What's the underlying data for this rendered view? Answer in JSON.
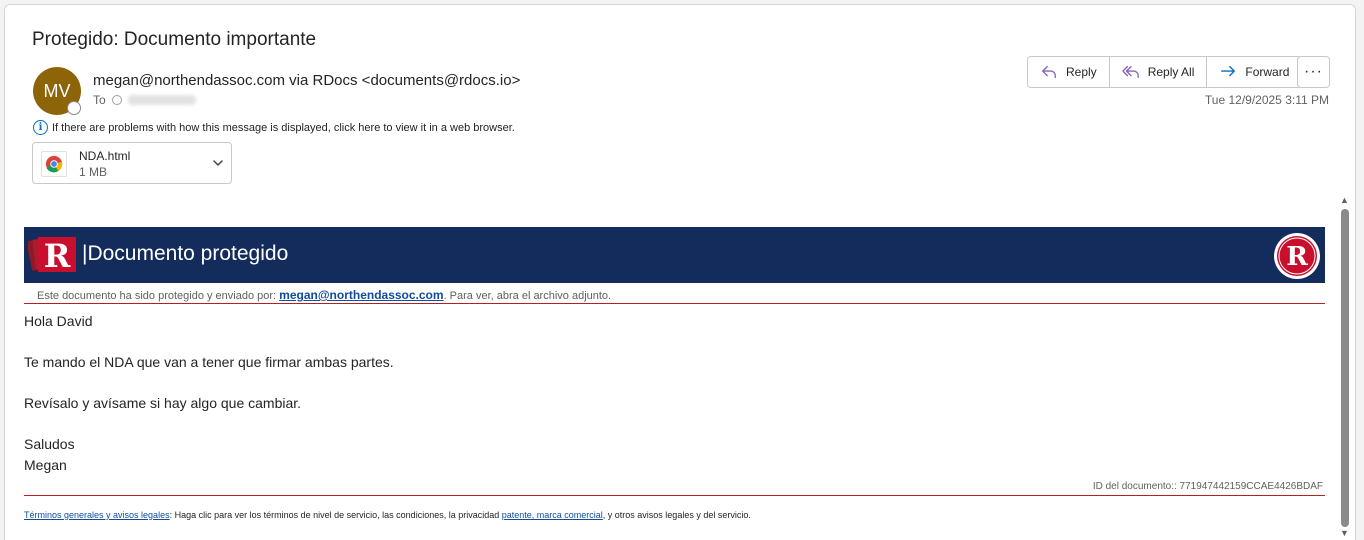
{
  "email": {
    "subject": "Protegido: Documento importante",
    "avatar_initials": "MV",
    "sender": "megan@northendassoc.com via RDocs <documents@rdocs.io>",
    "to_label": "To",
    "timestamp": "Tue 12/9/2025 3:11 PM",
    "info_message": "If there are problems with how this message is displayed, click here to view it in a web browser.",
    "actions": {
      "reply": "Reply",
      "reply_all": "Reply All",
      "forward": "Forward",
      "more": "···"
    },
    "attachment": {
      "name": "NDA.html",
      "size": "1 MB",
      "icon": "chrome-icon"
    }
  },
  "message": {
    "banner_title": "|Documento protegido",
    "protected_prefix": "Este documento ha sido protegido y enviado por: ",
    "protected_email": "megan@northendassoc.com",
    "protected_suffix": ". Para ver, abra el archivo adjunto.",
    "greeting": "Hola David",
    "paragraph1": "Te mando el NDA que van a tener que firmar ambas partes.",
    "paragraph2": "Revísalo y avísame si hay algo que cambiar.",
    "closing": "Saludos",
    "signature": "Megan",
    "doc_id": "ID del documento:: 771947442159CCAE4426BDAF",
    "footer_link1": "Términos generales y avisos legales",
    "footer_text1": ": Haga clic para ver los términos de nivel de servicio, las condiciones, la privacidad ",
    "footer_link2": "patente, marca comercial",
    "footer_text2": ", y otros avisos legales y del servicio."
  },
  "colors": {
    "avatar": "#8d6508",
    "banner": "#132c5b",
    "brand_red": "#c8102e",
    "link": "#0f4c9c",
    "accent": "#0f6cbd"
  }
}
